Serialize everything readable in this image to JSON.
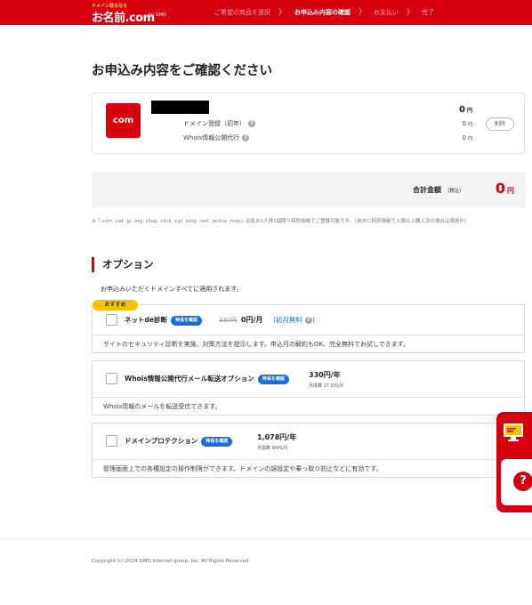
{
  "header": {
    "logo_tagline": "ドメイン取るなら",
    "logo_text": "お名前.com",
    "logo_gmo": "by GMO",
    "steps": [
      {
        "label": "ご希望の商品を選択"
      },
      {
        "label": "お申込み内容の確認"
      },
      {
        "label": "お支払い"
      },
      {
        "label": "完了"
      }
    ],
    "step_separator": "〉",
    "active_step": 1,
    "brand_color": "#d7000f"
  },
  "page_title": "お申込み内容をご確認ください",
  "domain_card": {
    "tld_icon": "com",
    "total": "0",
    "yen": "円",
    "lines": [
      {
        "label": "ドメイン登録（初年）",
        "price": "0"
      },
      {
        "label": "Whois情報公開代行",
        "price": "0"
      }
    ],
    "delete_label": "削除"
  },
  "total": {
    "label": "合計金額",
    "tax_note": "（税込）",
    "value": "0",
    "yen": "円"
  },
  "note": "※「.com .net .jp .org .shop .click .xyz .blog .test .online .help」は各お1人様1個限り特別価格でご登録可能です。（過去に特別価格で上限以上購入済の場合は適用外）",
  "options": {
    "title": "オプション",
    "description": "お申込みいただくドメインすべてに適用されます。",
    "recommend_badge": "おすすめ",
    "feature_label": "特長を確認",
    "items": [
      {
        "name": "ネットde診断",
        "strike_price": "330円",
        "price": "0円/月",
        "free_note": "(初月無料",
        "description": "サイトのセキュリティ診断を実施、対策方法を提示します。申込月の解約もOK、完全無料でお試しできます。",
        "checked": false
      },
      {
        "name": "Whois情報公開代行メール転送オプション",
        "price": "330円/年",
        "sub_price": "月換算 27.5円/月",
        "description": "Whois情報のメールを転送受信できます。",
        "checked": false
      },
      {
        "name": "ドメインプロテクション",
        "price": "1,078円/年",
        "sub_price": "月換算 90円/月",
        "description": "管理画面上での各種設定の操作制限ができます。ドメインの誤設定や乗っ取り防止などに有効です。",
        "checked": false
      }
    ]
  },
  "side_widget": {
    "top_icon": "monitor-icon",
    "help_icon": "?"
  },
  "footer": {
    "copyright": "Copyright (c) 2024 GMO Internet group, Inc. All Rights Reserved."
  }
}
